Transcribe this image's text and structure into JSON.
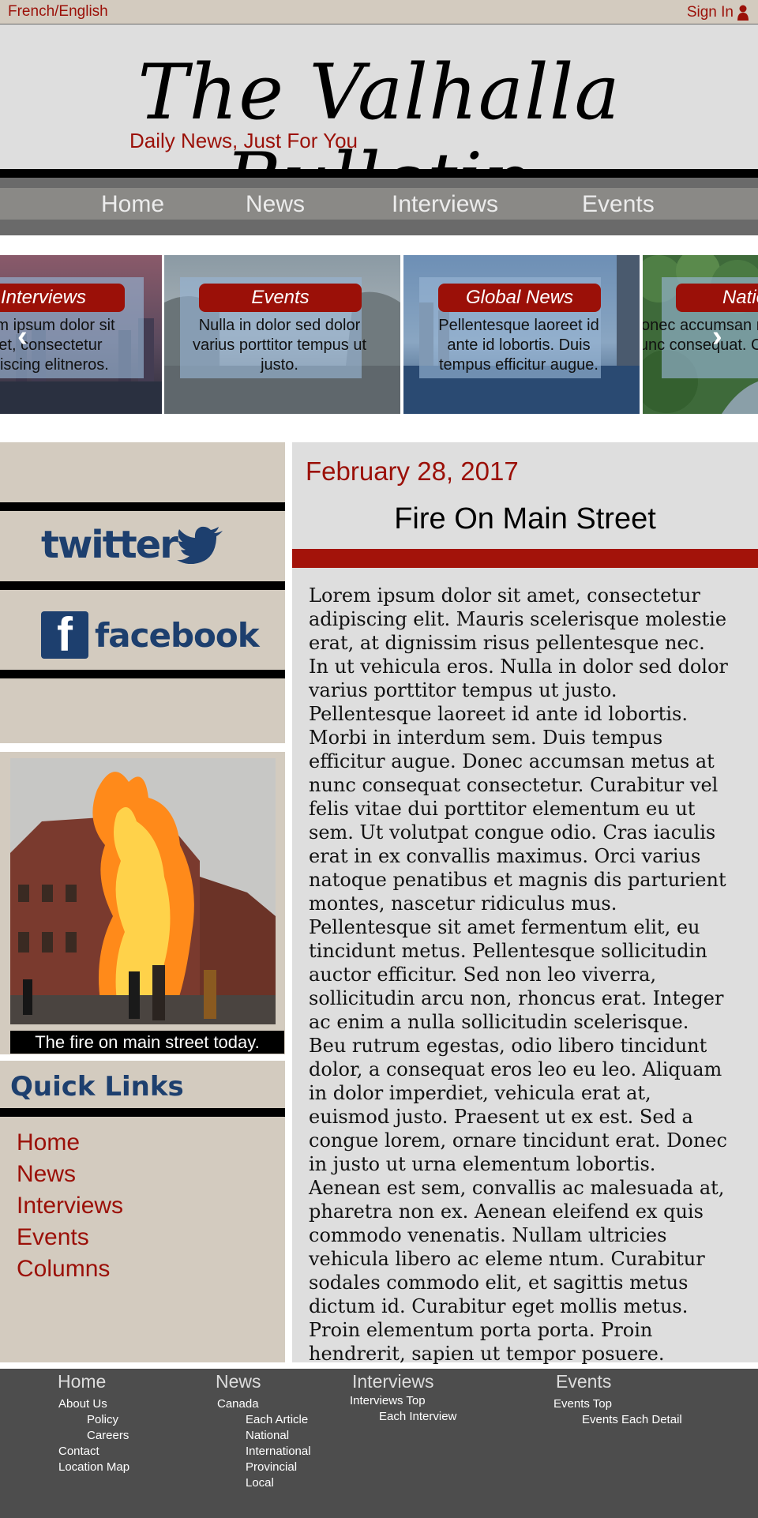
{
  "top_bar": {
    "language_label": "French/English",
    "sign_in_label": "Sign In"
  },
  "masthead": {
    "title": "The Valhalla Bulletin",
    "tagline": "Daily News, Just For You"
  },
  "nav": [
    "Home",
    "News",
    "Interviews",
    "Events"
  ],
  "carousel": {
    "slides": [
      {
        "label": "Interviews",
        "text": "Lorem ipsum dolor sit amet, consectetur adipiscing elitneros."
      },
      {
        "label": "Events",
        "text": "Nulla in dolor sed dolor varius porttitor tempus ut justo."
      },
      {
        "label": "Global News",
        "text": "Pellentesque laoreet id ante id lobortis. Duis tempus efficitur augue."
      },
      {
        "label": "National",
        "text": "Donec accumsan metus at nunc consequat. Curabitur"
      }
    ],
    "prev_icon": "chevron-left-icon",
    "next_icon": "chevron-right-icon"
  },
  "sidebar": {
    "twitter_label": "twitter",
    "facebook_label": "facebook",
    "photo_caption": "The fire on main street today.",
    "quick_links_title": "Quick Links",
    "quick_links": [
      "Home",
      "News",
      "Interviews",
      "Events",
      "Columns"
    ]
  },
  "article": {
    "date": "February 28, 2017",
    "headline": "Fire On Main Street",
    "paragraphs": [
      "Lorem ipsum dolor sit amet, consectetur adipiscing elit. Mauris scelerisque molestie erat, at dignissim risus pellentesque nec. In ut vehicula eros. Nulla in dolor sed dolor varius porttitor tempus ut justo. Pellentesque laoreet id ante id lobortis. Morbi in interdum sem. Duis tempus efficitur augue. Donec accumsan metus at nunc consequat consectetur. Curabitur vel felis vitae dui porttitor elementum eu ut sem. Ut volutpat congue odio. Cras iaculis erat in ex convallis maximus. Orci varius natoque penatibus et magnis dis parturient montes, nascetur ridiculus mus. Pellentesque sit amet fermentum elit, eu tincidunt metus. Pellentesque sollicitudin auctor efficitur. Sed non leo viverra, sollicitudin arcu non, rhoncus erat. Integer ac enim a nulla sollicitudin scelerisque.",
      "Beu rutrum egestas, odio libero tincidunt dolor, a consequat eros leo eu leo. Aliquam in dolor imperdiet, vehicula erat at, euismod justo. Praesent ut ex est. Sed a congue lorem, ornare tincidunt erat. Donec in justo ut urna elementum lobortis. Aenean est sem, convallis ac malesuada at, pharetra non ex. Aenean eleifend ex quis commodo venenatis. Nullam ultricies vehicula libero ac eleme ntum. Curabitur sodales commodo elit, et sagittis metus dictum id. Curabitur eget mollis metus. Proin elementum porta porta. Proin hendrerit, sapien ut tempor posuere."
    ]
  },
  "footer": {
    "columns": [
      {
        "heading": "Home",
        "links": [
          "About Us",
          "Policy",
          "Careers",
          "Contact",
          "Location Map"
        ]
      },
      {
        "heading": "News",
        "links": [
          "Canada",
          "Each Article",
          "National",
          "International",
          "Provincial",
          "Local"
        ]
      },
      {
        "heading": "Interviews",
        "links": [
          "Interviews Top",
          "Each Interview"
        ]
      },
      {
        "heading": "Events",
        "links": [
          "Events Top",
          "Events Each Detail"
        ]
      }
    ]
  },
  "colors": {
    "brand_red": "#9b1008",
    "brand_blue": "#1d3f6e",
    "beige": "#d3cbbf",
    "light_gray": "#dedede",
    "footer_gray": "#4d4d4d"
  }
}
